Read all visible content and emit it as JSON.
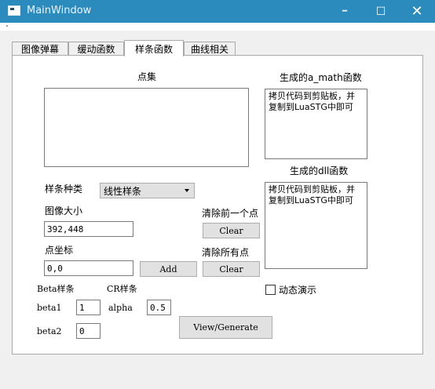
{
  "window": {
    "title": "MainWindow",
    "minimize_glyph": "━",
    "maximize_glyph": "☐",
    "close_glyph": "✕",
    "accent_color": "#2b8bbd"
  },
  "tabs": [
    {
      "label": "图像弹幕"
    },
    {
      "label": "缓动函数"
    },
    {
      "label": "样条函数",
      "active": true
    },
    {
      "label": "曲线相关"
    }
  ],
  "points": {
    "label": "点集",
    "value": ""
  },
  "a_math": {
    "label": "生成的a_math函数",
    "value": "拷贝代码到剪贴板，并\n复制到LuaSTG中即可"
  },
  "dll": {
    "label": "生成的dll函数",
    "value": "拷贝代码到剪贴板，并\n复制到LuaSTG中即可"
  },
  "spline_type": {
    "label": "样条种类",
    "selected": "线性样条"
  },
  "image_size": {
    "label": "图像大小",
    "value": "392,448"
  },
  "clear_prev": {
    "label": "清除前一个点",
    "button": "Clear"
  },
  "point_coord": {
    "label": "点坐标",
    "value": "0,0",
    "button": "Add"
  },
  "clear_all": {
    "label": "清除所有点",
    "button": "Clear"
  },
  "demo": {
    "label": "动态演示",
    "checked": false
  },
  "beta": {
    "label": "Beta样条",
    "beta1_label": "beta1",
    "beta1_value": "1",
    "beta2_label": "beta2",
    "beta2_value": "0"
  },
  "cr": {
    "label": "CR样条",
    "alpha_label": "alpha",
    "alpha_value": "0.5"
  },
  "generate_button": "View/Generate"
}
